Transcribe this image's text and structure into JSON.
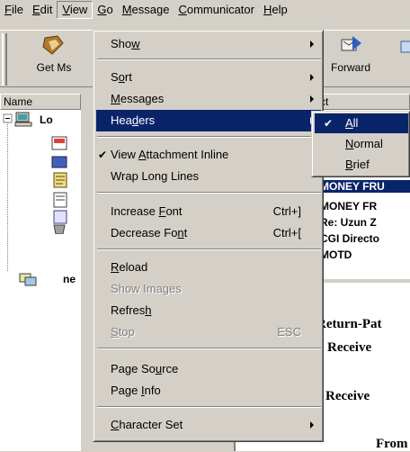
{
  "menubar": {
    "items": [
      {
        "pre": "",
        "u": "F",
        "post": "ile"
      },
      {
        "pre": "",
        "u": "E",
        "post": "dit"
      },
      {
        "pre": "",
        "u": "V",
        "post": "iew"
      },
      {
        "pre": "",
        "u": "G",
        "post": "o"
      },
      {
        "pre": "",
        "u": "M",
        "post": "essage"
      },
      {
        "pre": "",
        "u": "C",
        "post": "ommunicator"
      },
      {
        "pre": "",
        "u": "H",
        "post": "elp"
      }
    ]
  },
  "toolbar": {
    "get_msg_label": "Get Ms",
    "forward_label": "Forward"
  },
  "left_pane": {
    "column_name": "Name",
    "root_node": "Lo",
    "news_node": "ne"
  },
  "message_list": {
    "column_subject": "ct",
    "rows": [
      "MONEY FRU",
      "MONEY FR",
      "Re: Uzun Z",
      "CGI Directo",
      "MOTD"
    ]
  },
  "message_body": {
    "lines": [
      "Return-Pat",
      "Receive",
      "Receive",
      "From"
    ]
  },
  "view_menu": {
    "show": {
      "pre": "Sho",
      "u": "w",
      "post": ""
    },
    "sort": {
      "pre": "S",
      "u": "o",
      "post": "rt"
    },
    "messages": {
      "pre": "",
      "u": "M",
      "post": "essages"
    },
    "headers": {
      "pre": "Hea",
      "u": "d",
      "post": "ers"
    },
    "view_attachment": {
      "pre": "View ",
      "u": "A",
      "post": "ttachment Inline"
    },
    "wrap_long_lines": {
      "pre": "Wrap Long Lines",
      "u": "",
      "post": ""
    },
    "increase_font": {
      "pre": "Increase ",
      "u": "F",
      "post": "ont"
    },
    "increase_font_sc": "Ctrl+]",
    "decrease_font": {
      "pre": "Decrease Fo",
      "u": "n",
      "post": "t"
    },
    "decrease_font_sc": "Ctrl+[",
    "reload": {
      "pre": "",
      "u": "R",
      "post": "eload"
    },
    "show_images": {
      "pre": "Show Images",
      "u": "",
      "post": ""
    },
    "refresh": {
      "pre": "Refres",
      "u": "h",
      "post": ""
    },
    "stop": {
      "pre": "",
      "u": "S",
      "post": "top"
    },
    "stop_sc": "ESC",
    "page_source": {
      "pre": "Page So",
      "u": "u",
      "post": "rce"
    },
    "page_info": {
      "pre": "Page ",
      "u": "I",
      "post": "nfo"
    },
    "character_set": {
      "pre": "",
      "u": "C",
      "post": "haracter Set"
    }
  },
  "headers_submenu": {
    "all": {
      "pre": "",
      "u": "A",
      "post": "ll"
    },
    "normal": {
      "pre": "",
      "u": "N",
      "post": "ormal"
    },
    "brief": {
      "pre": "",
      "u": "B",
      "post": "rief"
    }
  },
  "colors": {
    "highlight": "#0a246a",
    "face": "#d4d0c8"
  }
}
